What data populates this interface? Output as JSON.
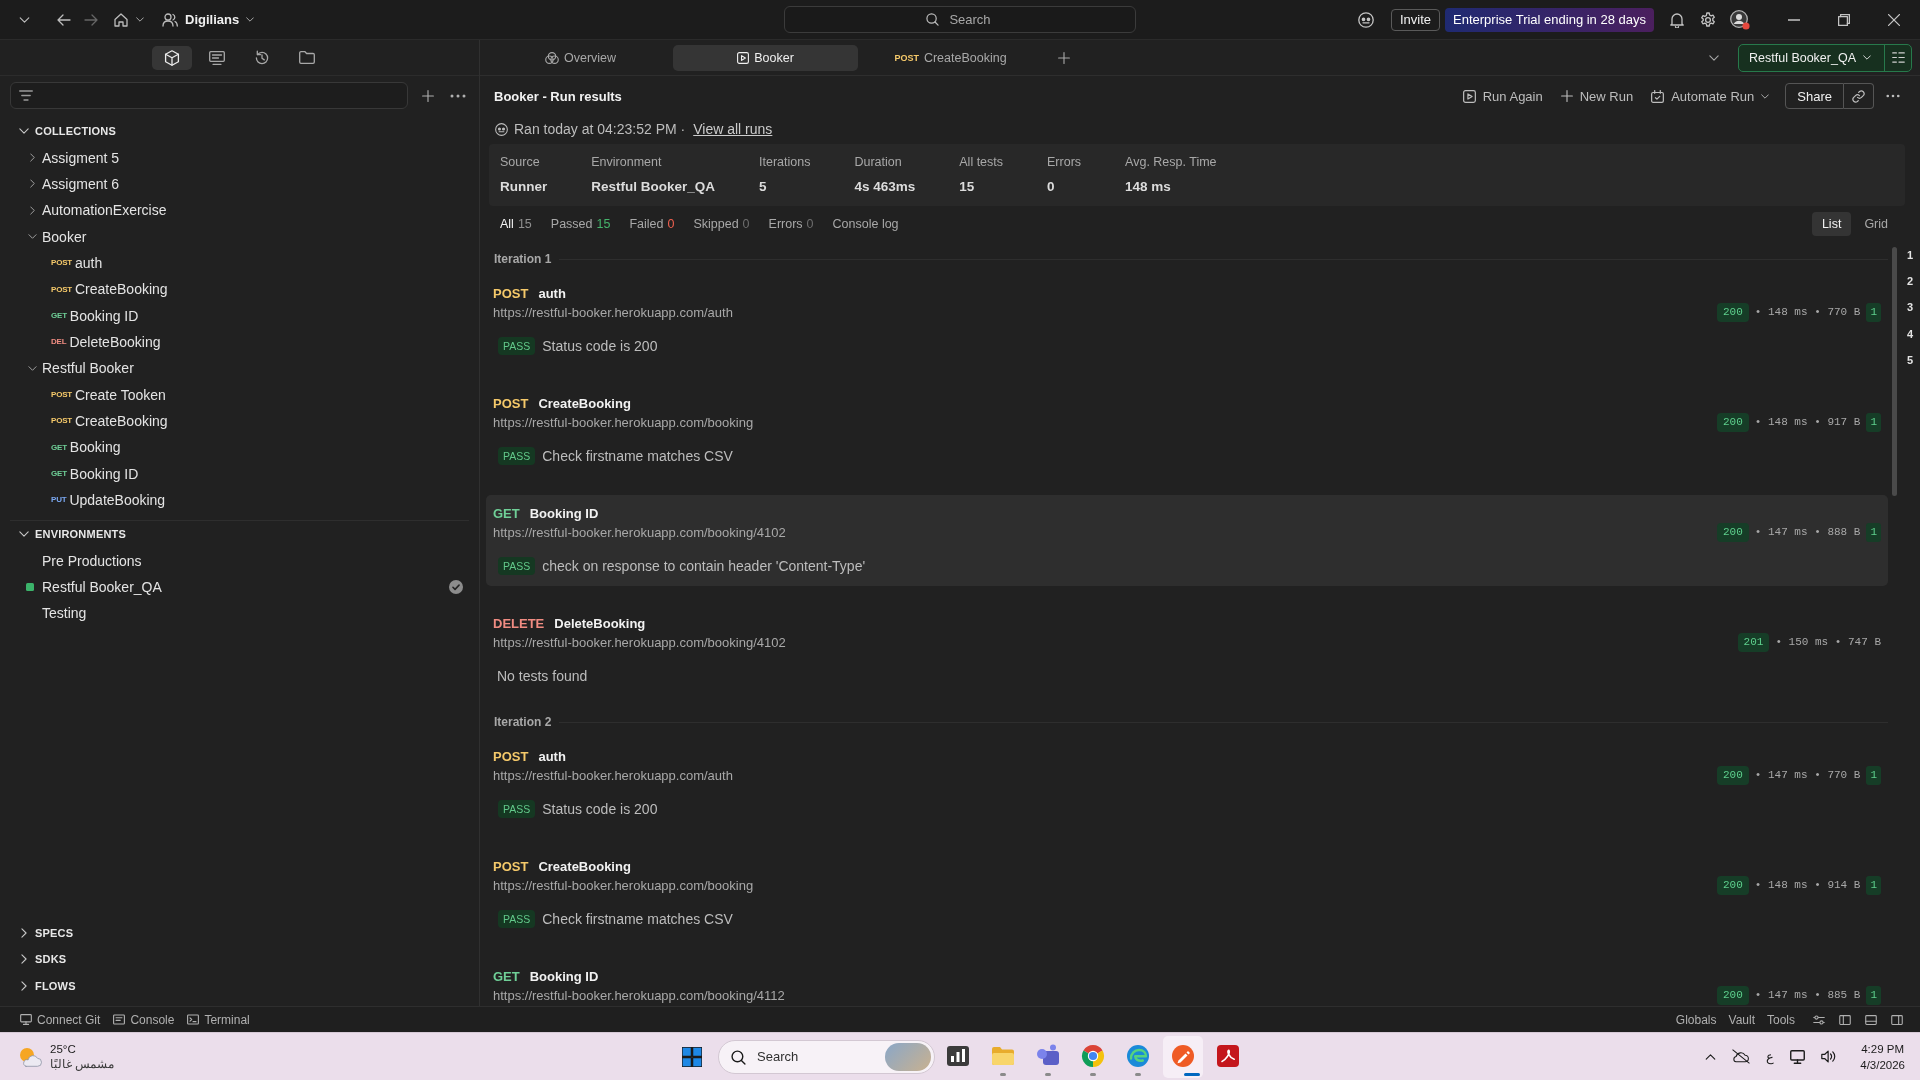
{
  "title_bar": {
    "workspace": "Digilians",
    "search": {
      "placeholder": "Search"
    },
    "invite": "Invite",
    "trial_banner": "Enterprise Trial ending in 28 days"
  },
  "sidebar": {
    "nav": [
      {
        "kind": "collections",
        "selected": true
      },
      {
        "kind": "environments",
        "selected": false
      },
      {
        "kind": "history",
        "selected": false
      },
      {
        "kind": "files",
        "selected": false
      }
    ],
    "collections": {
      "title": "COLLECTIONS",
      "expanded": true,
      "items": [
        {
          "kind": "folder",
          "label": "Assigment 5",
          "expanded": false
        },
        {
          "kind": "folder",
          "label": "Assigment 6",
          "expanded": false
        },
        {
          "kind": "folder",
          "label": "AutomationExercise",
          "expanded": false
        },
        {
          "kind": "folder",
          "label": "Booker",
          "expanded": true,
          "children": [
            {
              "kind": "request",
              "method": "POST",
              "color": "#f5c96a",
              "label": "auth"
            },
            {
              "kind": "request",
              "method": "POST",
              "color": "#f5c96a",
              "label": "CreateBooking"
            },
            {
              "kind": "request",
              "method": "GET",
              "color": "#6fcf97",
              "label": "Booking ID"
            },
            {
              "kind": "request",
              "method": "DEL",
              "color": "#f08c82",
              "label": "DeleteBooking"
            }
          ]
        },
        {
          "kind": "folder",
          "label": "Restful Booker",
          "expanded": true,
          "children": [
            {
              "kind": "request",
              "method": "POST",
              "color": "#f5c96a",
              "label": "Create Tooken"
            },
            {
              "kind": "request",
              "method": "POST",
              "color": "#f5c96a",
              "label": "CreateBooking"
            },
            {
              "kind": "request",
              "method": "GET",
              "color": "#6fcf97",
              "label": "Booking"
            },
            {
              "kind": "request",
              "method": "GET",
              "color": "#6fcf97",
              "label": "Booking ID"
            },
            {
              "kind": "request",
              "method": "PUT",
              "color": "#7aa7f0",
              "label": "UpdateBooking"
            }
          ]
        }
      ]
    },
    "environments": {
      "title": "ENVIRONMENTS",
      "expanded": true,
      "items": [
        {
          "label": "Pre Productions",
          "active": false
        },
        {
          "label": "Restful Booker_QA",
          "active": true
        },
        {
          "label": "Testing",
          "active": false
        }
      ]
    },
    "sections": [
      {
        "title": "SPECS",
        "expanded": false
      },
      {
        "title": "SDKS",
        "expanded": false
      },
      {
        "title": "FLOWS",
        "expanded": false
      }
    ]
  },
  "tabs": [
    {
      "kind": "overview",
      "label": "Overview",
      "selected": false
    },
    {
      "kind": "runner",
      "label": "Booker",
      "selected": true
    },
    {
      "kind": "request",
      "method": "POST",
      "color": "#f5c96a",
      "label": "CreateBooking",
      "selected": false
    }
  ],
  "environment_selector": {
    "label": "Restful Booker_QA"
  },
  "run": {
    "title": "Booker - Run results",
    "actions": [
      {
        "kind": "run",
        "label": "Run Again"
      },
      {
        "kind": "new",
        "label": "New Run"
      },
      {
        "kind": "automate",
        "label": "Automate Run"
      }
    ],
    "share": "Share",
    "ran_at": "Ran today at 04:23:52 PM ·",
    "view_all": "View all runs",
    "stats": [
      {
        "label": "Source",
        "value": "Runner"
      },
      {
        "label": "Environment",
        "value": "Restful Booker_QA"
      },
      {
        "label": "Iterations",
        "value": "5"
      },
      {
        "label": "Duration",
        "value": "4s 463ms"
      },
      {
        "label": "All tests",
        "value": "15"
      },
      {
        "label": "Errors",
        "value": "0"
      },
      {
        "label": "Avg. Resp. Time",
        "value": "148 ms"
      }
    ],
    "filters": [
      {
        "label": "All",
        "count": "15",
        "color": "#8f8f8f",
        "selected": true
      },
      {
        "label": "Passed",
        "count": "15",
        "color": "#45b26b",
        "selected": false
      },
      {
        "label": "Failed",
        "count": "0",
        "color": "#f0604f",
        "selected": false
      },
      {
        "label": "Skipped",
        "count": "0",
        "color": "#6e6e6e",
        "selected": false
      },
      {
        "label": "Errors",
        "count": "0",
        "color": "#6e6e6e",
        "selected": false
      },
      {
        "label": "Console log",
        "selected": false
      }
    ],
    "views": [
      {
        "label": "List",
        "selected": true
      },
      {
        "label": "Grid",
        "selected": false
      }
    ],
    "iterations": [
      {
        "label": "Iteration 1",
        "requests": [
          {
            "method": "POST",
            "color": "#f5c96a",
            "name": "auth",
            "url": "https://restful-booker.herokuapp.com/auth",
            "status": "200",
            "meta": "• 148 ms • 770 B",
            "test_count": "1",
            "highlighted": false,
            "tests": [
              {
                "result": "PASS",
                "name": "Status code is 200"
              }
            ]
          },
          {
            "method": "POST",
            "color": "#f5c96a",
            "name": "CreateBooking",
            "url": "https://restful-booker.herokuapp.com/booking",
            "status": "200",
            "meta": "• 148 ms • 917 B",
            "test_count": "1",
            "highlighted": false,
            "tests": [
              {
                "result": "PASS",
                "name": "Check firstname matches CSV"
              }
            ]
          },
          {
            "method": "GET",
            "color": "#6fcf97",
            "name": "Booking ID",
            "url": "https://restful-booker.herokuapp.com/booking/4102",
            "status": "200",
            "meta": "• 147 ms • 888 B",
            "test_count": "1",
            "highlighted": true,
            "tests": [
              {
                "result": "PASS",
                "name": "check on response to contain header 'Content-Type'"
              }
            ]
          },
          {
            "method": "DELETE",
            "color": "#f08c82",
            "name": "DeleteBooking",
            "url": "https://restful-booker.herokuapp.com/booking/4102",
            "status": "201",
            "meta": "• 150 ms • 747 B",
            "highlighted": false,
            "empty_message": "No tests found"
          }
        ]
      },
      {
        "label": "Iteration 2",
        "requests": [
          {
            "method": "POST",
            "color": "#f5c96a",
            "name": "auth",
            "url": "https://restful-booker.herokuapp.com/auth",
            "status": "200",
            "meta": "• 147 ms • 770 B",
            "test_count": "1",
            "highlighted": false,
            "tests": [
              {
                "result": "PASS",
                "name": "Status code is 200"
              }
            ]
          },
          {
            "method": "POST",
            "color": "#f5c96a",
            "name": "CreateBooking",
            "url": "https://restful-booker.herokuapp.com/booking",
            "status": "200",
            "meta": "• 148 ms • 914 B",
            "test_count": "1",
            "highlighted": false,
            "tests": [
              {
                "result": "PASS",
                "name": "Check firstname matches CSV"
              }
            ]
          },
          {
            "method": "GET",
            "color": "#6fcf97",
            "name": "Booking ID",
            "url": "https://restful-booker.herokuapp.com/booking/4112",
            "status": "200",
            "meta": "• 147 ms • 885 B",
            "test_count": "1",
            "highlighted": false
          }
        ]
      }
    ],
    "iteration_nav": [
      "1",
      "2",
      "3",
      "4",
      "5"
    ]
  },
  "status_bar": {
    "left": [
      {
        "kind": "git",
        "label": "Connect Git"
      },
      {
        "kind": "console",
        "label": "Console"
      },
      {
        "kind": "terminal",
        "label": "Terminal"
      }
    ],
    "right": [
      "Globals",
      "Vault",
      "Tools"
    ]
  },
  "taskbar": {
    "weather": {
      "temperature": "25°C",
      "condition": "مشمس غالبًا"
    },
    "search": {
      "placeholder": "Search"
    },
    "apps": [
      {
        "kind": "chart",
        "open": false,
        "active": false
      },
      {
        "kind": "folder",
        "open": true,
        "active": false
      },
      {
        "kind": "people",
        "open": true,
        "active": false
      },
      {
        "kind": "ring",
        "open": true,
        "active": false
      },
      {
        "kind": "swirl",
        "open": true,
        "active": false
      },
      {
        "kind": "pencil",
        "open": true,
        "active": true
      },
      {
        "kind": "curve",
        "open": false,
        "active": false
      }
    ],
    "language": "ع",
    "time": "4:29 PM",
    "date": "4/3/2026"
  }
}
